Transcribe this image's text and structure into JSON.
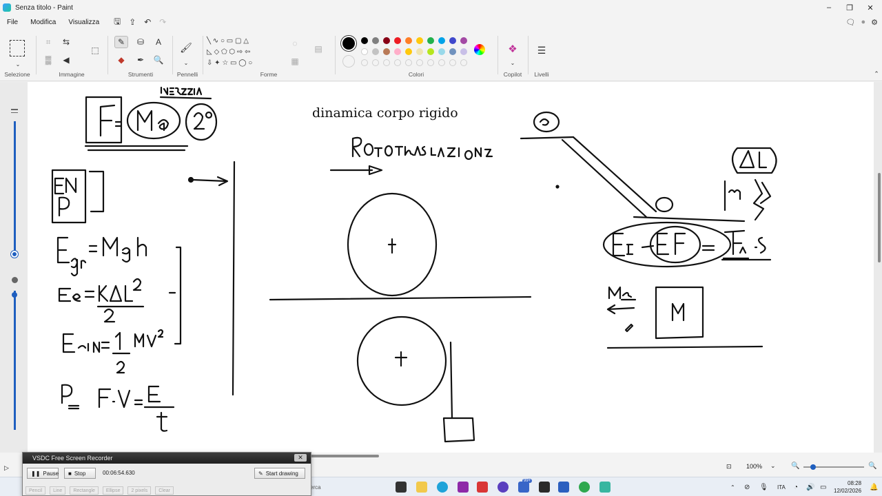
{
  "window": {
    "title": "Senza titolo - Paint",
    "minimize": "–",
    "maximize": "❐",
    "close": "✕"
  },
  "menu": {
    "items": [
      "File",
      "Modifica",
      "Visualizza"
    ]
  },
  "ribbon": {
    "groups": {
      "selection": "Selezione",
      "image": "Immagine",
      "tools": "Strumenti",
      "brushes": "Pennelli",
      "shapes": "Forme",
      "colors": "Colori",
      "copilot": "Copilot",
      "layers": "Livelli"
    },
    "palette_row1": [
      "#000000",
      "#7f7f7f",
      "#880015",
      "#ed1c24",
      "#ff7f27",
      "#ffc90e",
      "#22b14c",
      "#00a2e8",
      "#3f48cc",
      "#a349a4"
    ],
    "palette_row2": [
      "#ffffff",
      "#c3c3c3",
      "#b97a57",
      "#ffaec9",
      "#ffc90e",
      "#efe4b0",
      "#b5e61d",
      "#99d9ea",
      "#7092be",
      "#c8bfe7"
    ],
    "selected_color": "#000000",
    "secondary_color": "#ffffff"
  },
  "canvas": {
    "text_box": "dinamica corpo rigido",
    "handwritten_labels": [
      "F = Ma",
      "INERZIA",
      "2°",
      "EN",
      "P",
      "Egr = Mgh",
      "Ee = kΔl²/2",
      "Ecin = 1/2 Mv²",
      "P = F·V = E/t",
      "ROTOTRASLAZIONE",
      "Δl",
      "m",
      "EI - EF = FA·S",
      "Ma",
      "M"
    ]
  },
  "statusbar": {
    "zoom": "100%"
  },
  "recorder": {
    "title": "VSDC Free Screen Recorder",
    "pause": "Pause",
    "stop": "Stop",
    "time": "00:06:54.630",
    "start_drawing": "Start drawing",
    "tools": [
      "Pencil",
      "Line",
      "Rectangle",
      "Ellipse",
      "2 pixels",
      "Clear"
    ]
  },
  "taskbar": {
    "search_suffix": "erca",
    "lang": "ITA",
    "time": "08:28",
    "date": "12/02/2026",
    "badge": "99+"
  }
}
